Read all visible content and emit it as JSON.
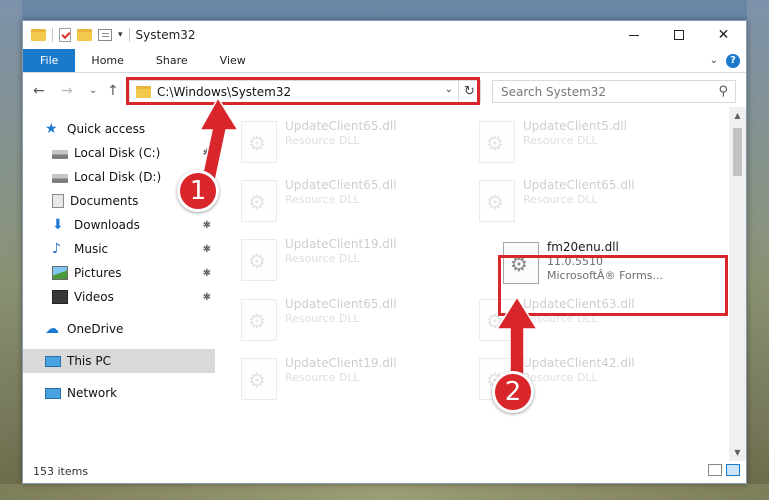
{
  "window": {
    "title": "System32",
    "close_glyph": "✕"
  },
  "ribbon": {
    "tabs": [
      "File",
      "Home",
      "Share",
      "View"
    ],
    "help": "?"
  },
  "nav": {
    "back": "←",
    "forward": "→",
    "recent": "⌄",
    "up": "↑",
    "address": "C:\\Windows\\System32",
    "refresh": "↻",
    "search_placeholder": "Search System32"
  },
  "sidebar": {
    "items": [
      {
        "label": "Quick access",
        "icon": "star-icon"
      },
      {
        "label": "Local Disk (C:)",
        "icon": "disk-icon"
      },
      {
        "label": "Local Disk (D:)",
        "icon": "disk-icon"
      },
      {
        "label": "Documents",
        "icon": "documents-icon"
      },
      {
        "label": "Downloads",
        "icon": "downloads-icon"
      },
      {
        "label": "Music",
        "icon": "music-icon"
      },
      {
        "label": "Pictures",
        "icon": "pictures-icon"
      },
      {
        "label": "Videos",
        "icon": "videos-icon"
      },
      {
        "label": "OneDrive",
        "icon": "onedrive-icon"
      },
      {
        "label": "This PC",
        "icon": "this-pc-icon"
      },
      {
        "label": "Network",
        "icon": "network-icon"
      }
    ]
  },
  "files": [
    {
      "name": "UpdateClient65.dll",
      "sub": "Resource DLL"
    },
    {
      "name": "UpdateClient5.dll",
      "sub": "Resource DLL"
    },
    {
      "name": "UpdateClient65.dll",
      "sub": "Resource DLL"
    },
    {
      "name": "UpdateClient65.dll",
      "sub": "Resource DLL"
    },
    {
      "name": "UpdateClient19.dll",
      "sub": "Resource DLL"
    },
    {
      "name": "fm20enu.dll",
      "version": "11.0.5510",
      "sub": "MicrosoftÂ® Forms..."
    },
    {
      "name": "UpdateClient65.dll",
      "sub": "Resource DLL"
    },
    {
      "name": "UpdateClient63.dll",
      "sub": "Resource DLL"
    },
    {
      "name": "UpdateClient19.dll",
      "sub": "Resource DLL"
    },
    {
      "name": "UpdateClient42.dll",
      "sub": "Resource DLL"
    }
  ],
  "status": {
    "count": "153 items"
  },
  "annotations": {
    "step1": "1",
    "step2": "2",
    "color": "#d9262b"
  }
}
